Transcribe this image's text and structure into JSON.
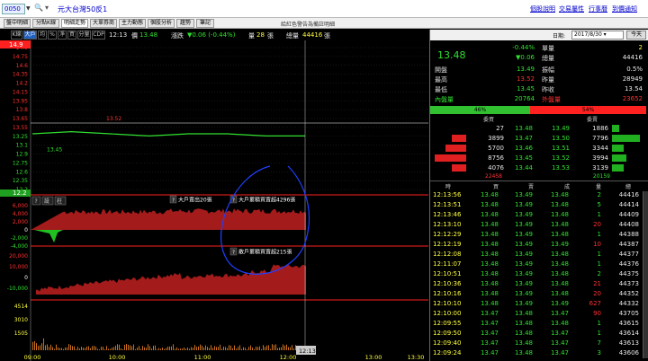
{
  "topbar": {
    "code": "0050",
    "stock_name": "元大台灣50反1",
    "links": [
      "個股說明",
      "交易屬性",
      "行事曆",
      "到價通知"
    ]
  },
  "tabs": [
    "盤中明細",
    "分點K線",
    "明細走勢",
    "大單券商",
    "主力動態",
    "個股分析",
    "趨勢",
    "筆記"
  ],
  "active_tab": "明細走勢",
  "tab_message": "給紅色警告為備註明細",
  "chartbar": {
    "buttons": [
      "K線",
      "大戶",
      "均",
      "%",
      "淨",
      "買",
      "分量",
      "CDP"
    ],
    "time": "12:13",
    "price_label": "價",
    "price": "13.48",
    "change_label": "漲跌",
    "change": "▼0.06 (-0.44%)",
    "volume_label": "量",
    "volume": "28",
    "unit": "張",
    "total_label": "總量",
    "total": "44416",
    "total_unit": "張"
  },
  "chart_data": [
    {
      "type": "line",
      "title": "",
      "yticks": [
        "14.9",
        "14.75",
        "14.6",
        "14.35",
        "14.2",
        "14.15",
        "13.95",
        "13.8",
        "13.65",
        "13.55",
        "13.25",
        "13.1",
        "12.9",
        "12.75",
        "12.6",
        "12.35",
        "12.2"
      ],
      "ylim": [
        12.2,
        14.9
      ],
      "markers": [
        {
          "label": "13.52",
          "value": 13.52
        },
        {
          "label": "13.45",
          "value": 13.45
        }
      ],
      "x": [
        "09:00",
        "09:30",
        "10:00",
        "10:30",
        "11:00",
        "11:30",
        "12:00",
        "12:13"
      ],
      "values": [
        13.49,
        13.5,
        13.49,
        13.48,
        13.49,
        13.49,
        13.48,
        13.48
      ]
    },
    {
      "type": "area",
      "title": "大戶",
      "annotations": [
        "大戶賣出20張",
        "大戶累積買賣超4296張"
      ],
      "yticks": [
        "6,000",
        "4,000",
        "2,000",
        "0",
        "-2,000",
        "-4,000"
      ]
    },
    {
      "type": "area",
      "title": "散戶",
      "annotations": [
        "散戶累積買賣超215張"
      ],
      "yticks": [
        "20,000",
        "10,000",
        "0",
        "-10,000"
      ]
    },
    {
      "type": "bar",
      "title": "量",
      "yticks": [
        "4514",
        "3010",
        "1505"
      ],
      "xticks": [
        "09:00",
        "10:00",
        "11:00",
        "12:00",
        "13:00",
        "13:30"
      ],
      "time_cursor": "12:13"
    }
  ],
  "chart_toolbar": [
    "?",
    "設",
    "柱"
  ],
  "chart_labels": {
    "top_price": "14.9",
    "bottom_price": "12.2"
  },
  "quote": {
    "price": "13.48",
    "change_pct": "-0.44%",
    "change": "▼0.06",
    "single_vol_label": "單量",
    "single_vol": "2",
    "total_vol_label": "總量",
    "total_vol": "44416",
    "rows": [
      {
        "label": "開盤",
        "value": "13.49",
        "label2": "振幅",
        "value2": "0.5%"
      },
      {
        "label": "最高",
        "value": "13.52",
        "label2": "昨量",
        "value2": "28949"
      },
      {
        "label": "最低",
        "value": "13.45",
        "label2": "昨收",
        "value2": "13.54"
      },
      {
        "label": "內盤量",
        "value": "20764",
        "label2": "外盤量",
        "value2": "23652"
      }
    ],
    "ratio_buy": "46%",
    "ratio_sell": "54%"
  },
  "orderbook": {
    "headers": [
      "委買",
      "委賣"
    ],
    "rows": [
      {
        "bid_vol": "27",
        "bid": "13.48",
        "ask": "13.49",
        "ask_vol": "1886"
      },
      {
        "bid_vol": "3899",
        "bid": "13.47",
        "ask": "13.50",
        "ask_vol": "7796"
      },
      {
        "bid_vol": "5700",
        "bid": "13.46",
        "ask": "13.51",
        "ask_vol": "3344"
      },
      {
        "bid_vol": "8756",
        "bid": "13.45",
        "ask": "13.52",
        "ask_vol": "3994"
      },
      {
        "bid_vol": "4076",
        "bid": "13.44",
        "ask": "13.53",
        "ask_vol": "3139"
      }
    ],
    "bid_total": "22458",
    "ask_total": "20159"
  },
  "ticks": {
    "headers": [
      "時",
      "買",
      "賣",
      "成",
      "量",
      "總"
    ],
    "rows": [
      {
        "time": "12:13:56",
        "bid": "13.48",
        "ask": "13.49",
        "price": "13.48",
        "vol": "2",
        "total": "44416"
      },
      {
        "time": "12:13:51",
        "bid": "13.48",
        "ask": "13.49",
        "price": "13.48",
        "vol": "5",
        "total": "44414"
      },
      {
        "time": "12:13:46",
        "bid": "13.48",
        "ask": "13.49",
        "price": "13.48",
        "vol": "1",
        "total": "44409"
      },
      {
        "time": "12:13:10",
        "bid": "13.48",
        "ask": "13.49",
        "price": "13.48",
        "vol": "20",
        "total": "44408"
      },
      {
        "time": "12:12:29",
        "bid": "13.48",
        "ask": "13.49",
        "price": "13.48",
        "vol": "1",
        "total": "44388"
      },
      {
        "time": "12:12:19",
        "bid": "13.48",
        "ask": "13.49",
        "price": "13.49",
        "vol": "10",
        "total": "44387"
      },
      {
        "time": "12:12:08",
        "bid": "13.48",
        "ask": "13.49",
        "price": "13.48",
        "vol": "1",
        "total": "44377"
      },
      {
        "time": "12:11:07",
        "bid": "13.48",
        "ask": "13.49",
        "price": "13.48",
        "vol": "1",
        "total": "44376"
      },
      {
        "time": "12:10:51",
        "bid": "13.48",
        "ask": "13.49",
        "price": "13.48",
        "vol": "2",
        "total": "44375"
      },
      {
        "time": "12:10:36",
        "bid": "13.48",
        "ask": "13.49",
        "price": "13.48",
        "vol": "21",
        "total": "44373"
      },
      {
        "time": "12:10:16",
        "bid": "13.48",
        "ask": "13.49",
        "price": "13.48",
        "vol": "20",
        "total": "44352"
      },
      {
        "time": "12:10:10",
        "bid": "13.48",
        "ask": "13.49",
        "price": "13.49",
        "vol": "627",
        "total": "44332"
      },
      {
        "time": "12:10:00",
        "bid": "13.47",
        "ask": "13.48",
        "price": "13.47",
        "vol": "90",
        "total": "43705"
      },
      {
        "time": "12:09:55",
        "bid": "13.47",
        "ask": "13.48",
        "price": "13.48",
        "vol": "1",
        "total": "43615"
      },
      {
        "time": "12:09:50",
        "bid": "13.47",
        "ask": "13.48",
        "price": "13.47",
        "vol": "1",
        "total": "43614"
      },
      {
        "time": "12:09:40",
        "bid": "13.47",
        "ask": "13.48",
        "price": "13.47",
        "vol": "7",
        "total": "43613"
      },
      {
        "time": "12:09:24",
        "bid": "13.47",
        "ask": "13.48",
        "price": "13.47",
        "vol": "3",
        "total": "43606"
      }
    ]
  },
  "colors": {
    "up": "#ff3030",
    "down": "#30e030",
    "flat": "#e8e8e8",
    "accent": "#ffff40"
  }
}
